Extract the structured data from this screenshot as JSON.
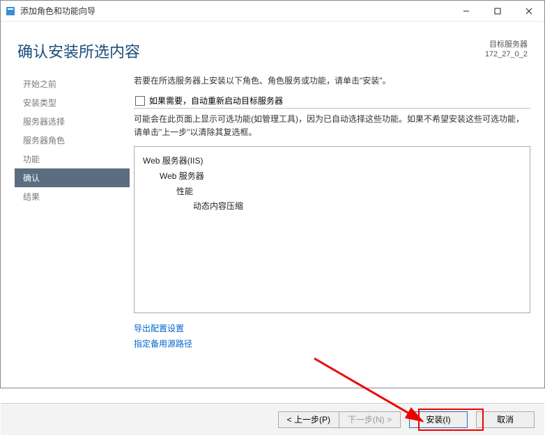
{
  "titlebar": {
    "title": "添加角色和功能向导"
  },
  "header": {
    "title": "确认安装所选内容",
    "server_label": "目标服务器",
    "server_name": "172_27_0_2"
  },
  "sidebar": {
    "items": [
      {
        "label": "开始之前"
      },
      {
        "label": "安装类型"
      },
      {
        "label": "服务器选择"
      },
      {
        "label": "服务器角色"
      },
      {
        "label": "功能"
      },
      {
        "label": "确认"
      },
      {
        "label": "结果"
      }
    ]
  },
  "main": {
    "intro": "若要在所选服务器上安装以下角色、角色服务或功能，请单击\"安装\"。",
    "checkbox_label": "如果需要，自动重新启动目标服务器",
    "note": "可能会在此页面上显示可选功能(如管理工具)，因为已自动选择这些功能。如果不希望安装这些可选功能，请单击\"上一步\"以清除其复选框。",
    "tree": [
      {
        "level": 0,
        "text": "Web 服务器(IIS)"
      },
      {
        "level": 1,
        "text": "Web 服务器"
      },
      {
        "level": 2,
        "text": "性能"
      },
      {
        "level": 3,
        "text": "动态内容压缩"
      }
    ],
    "links": {
      "export": "导出配置设置",
      "alt_source": "指定备用源路径"
    }
  },
  "footer": {
    "prev": "< 上一步(P)",
    "next": "下一步(N) >",
    "install": "安装(I)",
    "cancel": "取消"
  }
}
